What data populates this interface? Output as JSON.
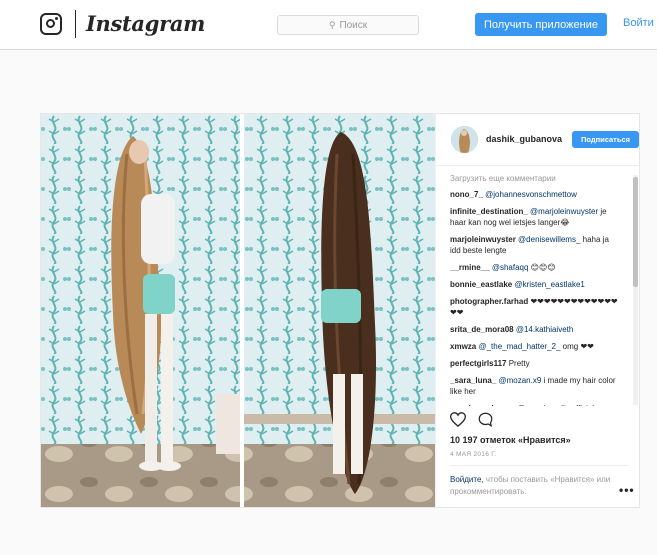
{
  "header": {
    "brand": "Instagram",
    "search_placeholder": "Поиск",
    "get_app_label": "Получить приложение",
    "login_label": "Войти"
  },
  "post": {
    "author": {
      "username": "dashik_gubanova",
      "follow_label": "Подписаться"
    },
    "load_more_label": "Загрузить еще комментарии",
    "comments": [
      {
        "user": "nono_7_",
        "text": "",
        "mention": "@johannesvonschmettow"
      },
      {
        "user": "infinite_destination_",
        "text": "je haar kan nog wel ietsjes langer😂",
        "mention": "@marjoleinwuyster"
      },
      {
        "user": "marjoleinwuyster",
        "text": "haha ja idd beste lengte",
        "mention": "@denisewillems_"
      },
      {
        "user": "__rmine__",
        "text": "😊😊😊",
        "mention": "@shafaqq"
      },
      {
        "user": "bonnie_eastlake",
        "text": "",
        "mention": "@kristen_eastlake1"
      },
      {
        "user": "photographer.farhad",
        "text": "❤❤❤❤❤❤❤❤❤❤❤❤❤❤❤",
        "mention": ""
      },
      {
        "user": "srita_de_mora08",
        "text": "",
        "mention": "@14.kathiaiveth"
      },
      {
        "user": "xmwza",
        "text": "omg ❤❤",
        "mention": "@_the_mad_hatter_2_"
      },
      {
        "user": "perfectgirls117",
        "text": "Pretty",
        "mention": ""
      },
      {
        "user": "_sara_luna_",
        "text": "i made my hair color like her",
        "mention": "@mozan.x9"
      },
      {
        "user": "annalee__dancer",
        "text": "",
        "mention": "@premiereeliteofficial"
      }
    ],
    "likes": "10 197 отметок «Нравится»",
    "date": "4 МАЯ 2016 Г.",
    "login_prompt": {
      "link": "Войдите,",
      "text": "чтобы поставить «Нравится» или прокомментировать."
    },
    "more_label": "•••"
  },
  "icons": {
    "logo": "instagram-glyph-icon",
    "search": "search-icon",
    "like": "heart-icon",
    "comment": "comment-bubble-icon",
    "more": "more-options-icon"
  },
  "colors": {
    "accent": "#3897f0",
    "text": "#262626",
    "muted": "#999999",
    "link": "#003569",
    "background": "#fafafa"
  }
}
